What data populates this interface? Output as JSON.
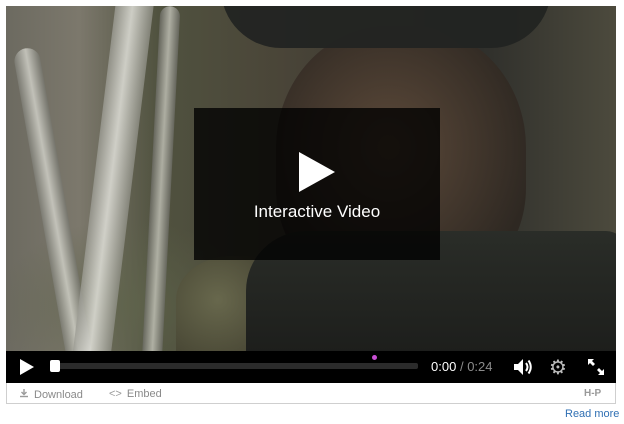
{
  "player": {
    "overlay_title": "Interactive Video",
    "time_current": "0:00",
    "time_separator": "/",
    "time_duration": "0:24",
    "progress": 0.0,
    "interaction_marker_fraction": 0.875,
    "marker_color": "#c94fd4",
    "icons": {
      "play_big": "play-icon",
      "play": "play-icon",
      "volume": "volume-icon",
      "settings": "gear-icon",
      "fullscreen": "fullscreen-icon"
    }
  },
  "footer": {
    "download_label": "Download",
    "embed_label": "Embed",
    "hp_logo": "H-P",
    "read_more": "Read more"
  }
}
